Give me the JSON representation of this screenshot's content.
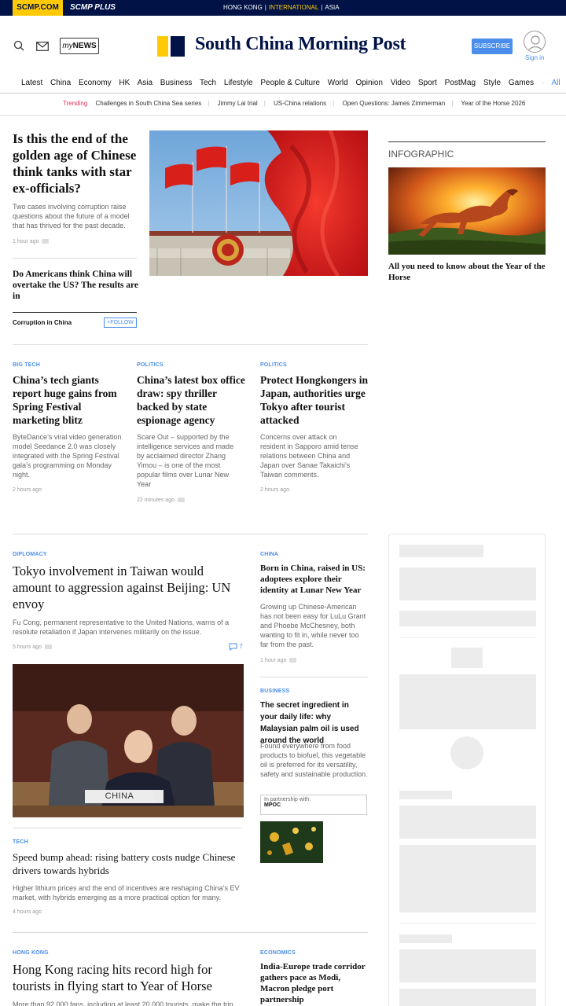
{
  "topbar": {
    "scmp_label": "SCMP.COM",
    "plus_label": "SCMP PLUS",
    "regions": [
      "HONG KONG",
      "INTERNATIONAL",
      "ASIA"
    ]
  },
  "header": {
    "mynews_my": "my",
    "mynews_news": "NEWS",
    "logo_text": "South China Morning Post",
    "subscribe_label": "SUBSCRIBE",
    "signin_label": "Sign in"
  },
  "nav": {
    "items": [
      "Latest",
      "China",
      "Economy",
      "HK",
      "Asia",
      "Business",
      "Tech",
      "Lifestyle",
      "People & Culture",
      "World",
      "Opinion",
      "Video",
      "Sport",
      "PostMag",
      "Style",
      "Games"
    ],
    "dot": "·",
    "all_label": "All"
  },
  "trending": {
    "label": "Trending",
    "items": [
      "Challenges in South China Sea series",
      "Jimmy Lai trial",
      "US-China relations",
      "Open Questions: James Zimmerman",
      "Year of the Horse 2026"
    ]
  },
  "lead": {
    "title": "Is this the end of the golden age of Chinese think tanks with star ex-officials?",
    "summary": "Two cases involving corruption raise questions about the future of a model that has thrived for the past decade.",
    "time": "1 hour ago",
    "related_title": "Do Americans think China will overtake the US? The results are in",
    "topic": "Corruption in China",
    "follow_label": "FOLLOW"
  },
  "infographic": {
    "label": "INFOGRAPHIC",
    "title": "All you need to know about the Year of the Horse"
  },
  "row2": [
    {
      "section": "BIG TECH",
      "title": "China’s tech giants report huge gains from Spring Festival marketing blitz",
      "summary": "ByteDance’s viral video generation model Seedance 2.0 was closely integrated with the Spring Festival gala’s programming on Monday night.",
      "time": "2 hours ago"
    },
    {
      "section": "POLITICS",
      "title": "China’s latest box office draw: spy thriller backed by state espionage agency",
      "summary": "Scare Out – supported by the intelligence services and made by acclaimed director Zhang Yimou – is one of the most popular films over Lunar New Year",
      "time": "22 minutes ago"
    },
    {
      "section": "POLITICS",
      "title": "Protect Hongkongers in Japan, authorities urge Tokyo after tourist attacked",
      "summary": "Concerns over attack on resident in Sapporo amid tense relations between China and Japan over Sanae Takaichi’s Taiwan comments.",
      "time": "2 hours ago"
    }
  ],
  "diplomacy": {
    "section": "DIPLOMACY",
    "title": "Tokyo involvement in Taiwan would amount to aggression against Beijing: UN envoy",
    "summary": "Fu Cong, permanent representative to the United Nations, warns of a resolute retaliation if Japan intervenes militarily on the issue.",
    "time": "5 hours ago",
    "comments": "7",
    "placard": "CHINA"
  },
  "china_story": {
    "section": "CHINA",
    "title": "Born in China, raised in US: adoptees explore their identity at Lunar New Year",
    "summary": "Growing up Chinese-American has not been easy for LuLu Grant and Phoebe McChesney, both wanting to fit in, while never too far from the past.",
    "time": "1 hour ago"
  },
  "business_story": {
    "section": "BUSINESS",
    "title": "The secret ingredient in your daily life: why Malaysian palm oil is used around the world",
    "summary": "Found everywhere from food products to biofuel, this vegetable oil is preferred for its versatility, safety and sustainable production.",
    "partner_label": "In partnership with:",
    "partner_name": "MPOC"
  },
  "tech_story": {
    "section": "TECH",
    "title": "Speed bump ahead: rising battery costs nudge Chinese drivers towards hybrids",
    "summary": "Higher lithium prices and the end of incentives are reshaping China’s EV market, with hybrids emerging as a more practical option for many.",
    "time": "4 hours ago"
  },
  "hk_story": {
    "section": "HONG KONG",
    "title": "Hong Kong racing hits record high for tourists in flying start to Year of Horse",
    "summary": "More than 92,000 fans, including at least 20,000 tourists, make the trip"
  },
  "econ_story": {
    "section": "ECONOMICS",
    "title": "India-Europe trade corridor gathers pace as Modi, Macron pledge port partnership"
  },
  "colors": {
    "navy": "#001246",
    "yellow": "#FFCA05",
    "accent": "#4A8DEB",
    "trending": "#E0315A"
  }
}
